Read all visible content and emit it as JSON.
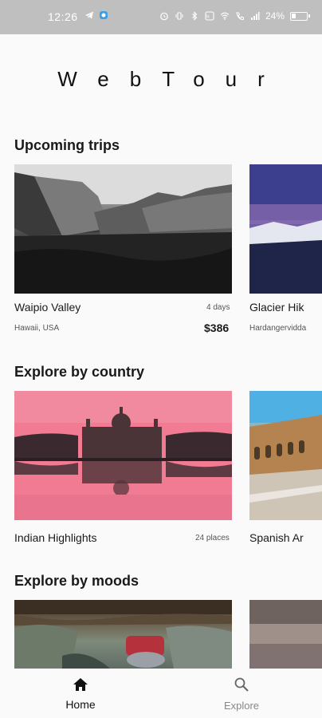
{
  "status_bar": {
    "time": "12:26",
    "battery_percent": "24%",
    "icons": [
      "telegram-icon",
      "app-icon",
      "alarm-icon",
      "vibrate-icon",
      "bluetooth-icon",
      "nfc-icon",
      "wifi-icon",
      "call-icon",
      "signal-icon",
      "battery-icon"
    ]
  },
  "app": {
    "title": "WebTour"
  },
  "sections": {
    "upcoming": {
      "title": "Upcoming trips",
      "cards": [
        {
          "name": "Waipio Valley",
          "location": "Hawaii, USA",
          "duration": "4 days",
          "price": "$386"
        },
        {
          "name": "Glacier Hik",
          "location": "Hardangervidda"
        }
      ]
    },
    "country": {
      "title": "Explore by country",
      "cards": [
        {
          "name": "Indian Highlights",
          "places": "24 places"
        },
        {
          "name": "Spanish Ar"
        }
      ]
    },
    "moods": {
      "title": "Explore by moods"
    }
  },
  "bottom_nav": {
    "home": {
      "label": "Home",
      "icon": "home-icon"
    },
    "explore": {
      "label": "Explore",
      "icon": "search-icon"
    }
  },
  "colors": {
    "status_bar": "#bfbfbf",
    "background": "#fafafa",
    "text": "#1a1a1a"
  }
}
